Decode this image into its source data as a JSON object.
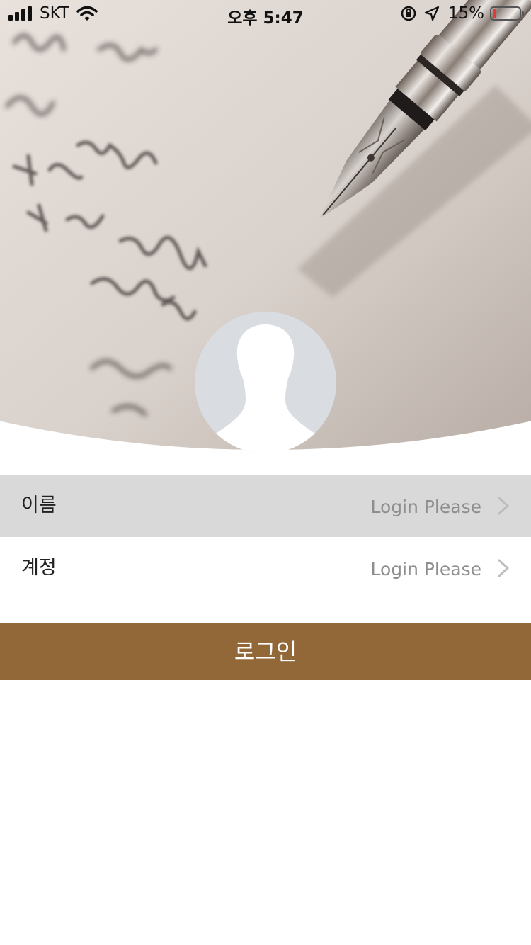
{
  "status_bar": {
    "carrier": "SKT",
    "time": "오후 5:47",
    "battery": "15%",
    "battery_level": 0.15,
    "icons": [
      "signal-icon",
      "wifi-icon",
      "orientation-lock-icon",
      "location-icon",
      "battery-icon"
    ]
  },
  "header": {
    "image": "fountain-pen-handwriting-photo",
    "avatar": "default-user-avatar"
  },
  "form": {
    "rows": [
      {
        "label": "이름",
        "value": "Login Please",
        "icon": "chevron-right-icon"
      },
      {
        "label": "계정",
        "value": "Login Please",
        "icon": "chevron-right-icon"
      }
    ]
  },
  "login_button": {
    "label": "로그인"
  },
  "colors": {
    "accent": "#936838",
    "row_highlight": "#d9d9d9",
    "value_text": "#8e8e8e",
    "battery_low": "#e53935"
  }
}
